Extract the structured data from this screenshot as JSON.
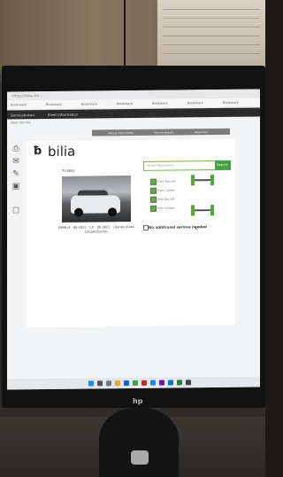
{
  "browser": {
    "url": "https://bilia-srv-..."
  },
  "bookmarks": [
    "Bookmark",
    "Bookmark",
    "Bookmark",
    "Bookmark",
    "Bookmark",
    "Bookmark",
    "Bookmark"
  ],
  "app_nav": {
    "left": "Serviceboken",
    "right": "Fleet Information"
  },
  "breadcrumb": "Fleet Service",
  "tabs": [
    "Vehicle Information",
    "Service Details",
    "Alignment"
  ],
  "brand": {
    "logo_text": "bilia"
  },
  "vehicle": {
    "registration": "TU 8082",
    "description": "BMW i4 · 08-2021 · 1 K · 08-2021 · i-Series (Gran Coupe) Electric"
  },
  "alignment": {
    "search_placeholder": "Wheel Alignment",
    "search_button": "Search"
  },
  "checklist": [
    {
      "label": "Front Toe Left"
    },
    {
      "label": "Front Camber"
    },
    {
      "label": "Rear Toe Left"
    },
    {
      "label": "Rear Camber"
    }
  ],
  "service_status": "No additional service needed",
  "colors": {
    "accent_green": "#43a047",
    "dark_nav": "#2b2b2b"
  },
  "icons": [
    "printer-icon",
    "mail-icon",
    "pencil-icon",
    "camera-icon",
    "trash-icon"
  ],
  "monitor_brand": "hp"
}
